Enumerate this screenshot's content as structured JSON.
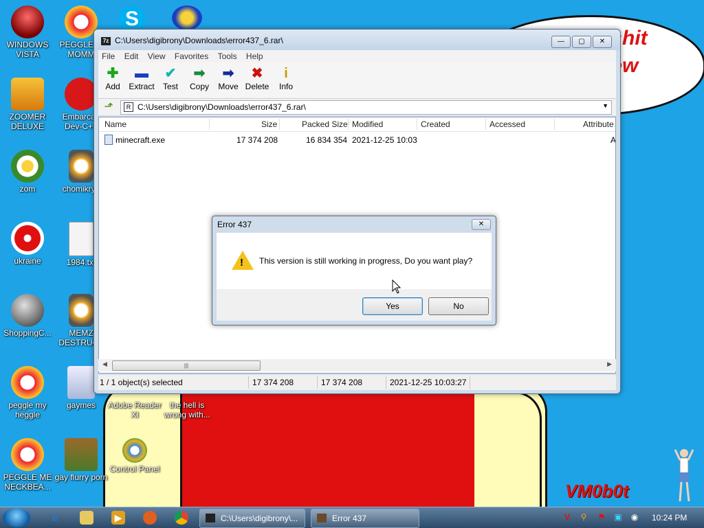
{
  "wallpaper": {
    "bubble_lines": [
      "t shit",
      "hew"
    ],
    "signature": "VM0b0t"
  },
  "desktop_icons": [
    {
      "label": "WINDOWS VISTA"
    },
    {
      "label": "PEGGLE M MOMM"
    },
    {
      "label": "ZOOMER DELUXE"
    },
    {
      "label": "Embarcad Dev-C++"
    },
    {
      "label": "zom"
    },
    {
      "label": "chomikryp"
    },
    {
      "label": "ukraine"
    },
    {
      "label": "1984.txt"
    },
    {
      "label": "ShoppingC..."
    },
    {
      "label": "MEMZ DESTRUCT"
    },
    {
      "label": "peggle my heggle"
    },
    {
      "label": "gaymes"
    },
    {
      "label": "Adobe Reader XI"
    },
    {
      "label": "the hell is wrong with..."
    },
    {
      "label": "PEGGLE ME NECKBEA..."
    },
    {
      "label": "gay flurry porn"
    },
    {
      "label": "Control Panel"
    }
  ],
  "window": {
    "title_icon": "7z",
    "title": "C:\\Users\\digibrony\\Downloads\\error437_6.rar\\",
    "controls": {
      "minimize": "—",
      "maximize": "▢",
      "close": "✕"
    },
    "menu": [
      "File",
      "Edit",
      "View",
      "Favorites",
      "Tools",
      "Help"
    ],
    "toolbar": [
      {
        "label": "Add",
        "glyph": "✚",
        "color": "#1aa61a"
      },
      {
        "label": "Extract",
        "glyph": "▬",
        "color": "#1a3fc0"
      },
      {
        "label": "Test",
        "glyph": "✔",
        "color": "#13b5b0"
      },
      {
        "label": "Copy",
        "glyph": "➡",
        "color": "#1a8a3a"
      },
      {
        "label": "Move",
        "glyph": "➡",
        "color": "#1a2a9a"
      },
      {
        "label": "Delete",
        "glyph": "✖",
        "color": "#d01010"
      },
      {
        "label": "Info",
        "glyph": "i",
        "color": "#c89a00"
      }
    ],
    "address": "C:\\Users\\digibrony\\Downloads\\error437_6.rar\\",
    "columns": [
      "Name",
      "Size",
      "Packed Size",
      "Modified",
      "Created",
      "Accessed",
      "Attribute"
    ],
    "rows": [
      {
        "name": "minecraft.exe",
        "size": "17 374 208",
        "packed": "16 834 354",
        "modified": "2021-12-25 10:03",
        "created": "",
        "accessed": "",
        "attr": "A"
      }
    ],
    "status": {
      "selected": "1 / 1 object(s) selected",
      "size": "17 374 208",
      "packed": "17 374 208",
      "modified": "2021-12-25 10:03:27"
    }
  },
  "dialog": {
    "title": "Error 437",
    "message": "This version is still working in progress, Do you want play?",
    "yes": "Yes",
    "no": "No"
  },
  "taskbar": {
    "tasks": [
      {
        "label": "C:\\Users\\digibrony\\..."
      },
      {
        "label": "Error 437"
      }
    ],
    "clock": "10:24 PM"
  }
}
